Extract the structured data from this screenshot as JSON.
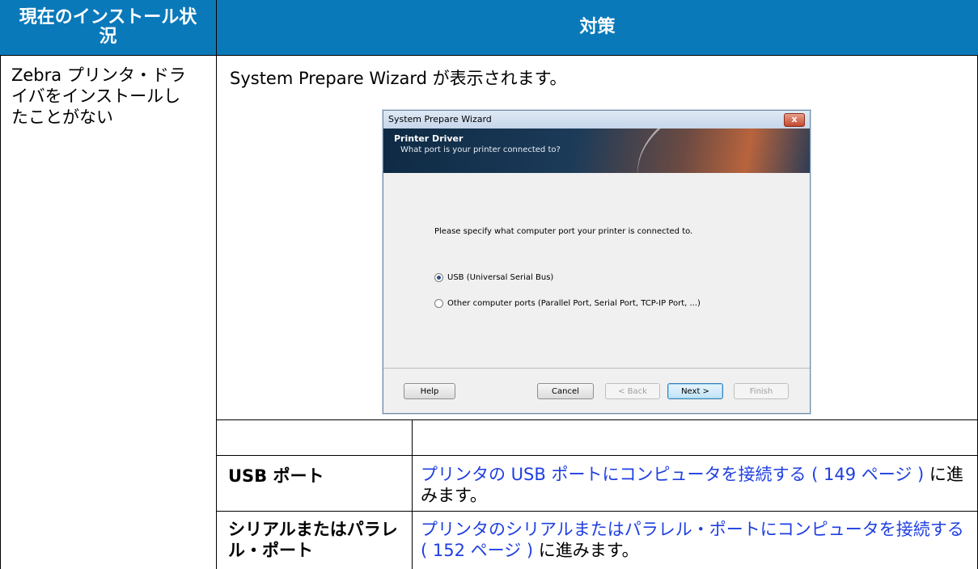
{
  "table": {
    "header_left": "現在のインストール状況",
    "header_right": "対策",
    "row1_left": "Zebra プリンタ・ドライバをインストールしたことがない",
    "row1_right": "System Prepare Wizard が表示されます。",
    "sub_rows": [
      {
        "left": "",
        "right": ""
      },
      {
        "left": "USB ポート",
        "right_link": "プリンタの USB ポートにコンピュータを接続する ( 149 ページ )",
        "right_suffix": " に進みます。"
      },
      {
        "left": "シリアルまたはパラレル・ポート",
        "right_link": "プリンタのシリアルまたはパラレル・ポートにコンピュータを接続する ( 152 ページ )",
        "right_suffix": " に進みます。"
      }
    ]
  },
  "dialog": {
    "title": "System Prepare Wizard",
    "close_label": "x",
    "banner_title": "Printer Driver",
    "banner_subtitle": "What port is your printer connected to?",
    "prompt": "Please specify what computer port your printer is connected to.",
    "options": [
      {
        "label": "USB (Universal Serial Bus)",
        "selected": true
      },
      {
        "label": "Other computer ports (Parallel Port, Serial Port, TCP-IP Port, ...)",
        "selected": false
      }
    ],
    "buttons": {
      "help": "Help",
      "cancel": "Cancel",
      "back": "< Back",
      "next": "Next >",
      "finish": "Finish"
    }
  },
  "colors": {
    "header_bg": "#0a79b9",
    "link": "#1f3fe0"
  }
}
